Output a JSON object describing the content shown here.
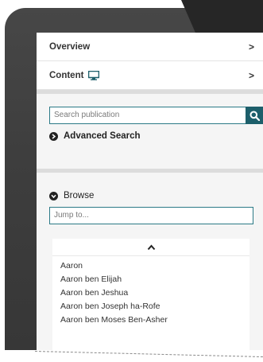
{
  "menu": {
    "overview_label": "Overview",
    "content_label": "Content",
    "chevron": ">"
  },
  "search": {
    "placeholder": "Search publication",
    "advanced_label": "Advanced Search"
  },
  "browse": {
    "title": "Browse",
    "jump_placeholder": "Jump to...",
    "items": [
      "Aaron",
      "Aaron ben Elijah",
      "Aaron ben Jeshua",
      "Aaron ben Joseph ha-Rofe",
      "Aaron ben Moses Ben-Asher"
    ]
  },
  "colors": {
    "accent": "#1d5f6b",
    "input_border": "#2b7a86",
    "bezel": "#3e3e3e"
  },
  "icons": {
    "content": "monitor-icon",
    "search": "search-icon",
    "advanced": "arrow-circle-right-icon",
    "browse": "chevron-circle-down-icon",
    "scroll_up": "chevron-up-icon"
  }
}
